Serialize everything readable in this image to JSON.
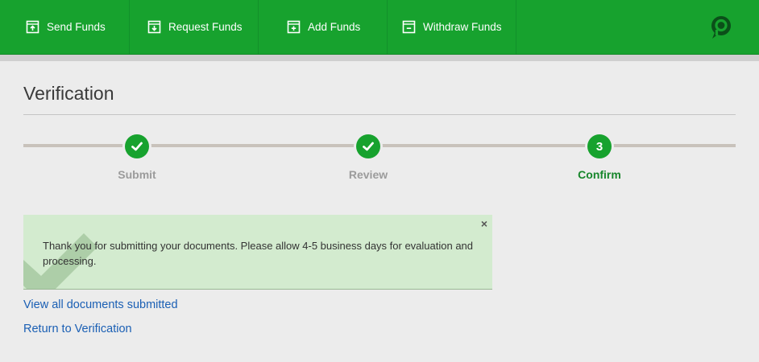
{
  "nav": {
    "items": [
      {
        "label": "Send Funds",
        "icon": "send-funds-icon"
      },
      {
        "label": "Request Funds",
        "icon": "request-funds-icon"
      },
      {
        "label": "Add Funds",
        "icon": "add-funds-icon"
      },
      {
        "label": "Withdraw Funds",
        "icon": "withdraw-funds-icon"
      }
    ],
    "logo": "brand-logo-icon"
  },
  "colors": {
    "brand_green": "#17a22e",
    "alert_background": "#d3ebcf",
    "link_blue": "#1a5fb4",
    "active_step": "#17862b",
    "inactive_step": "#9b9b9b"
  },
  "page": {
    "title": "Verification"
  },
  "steps": [
    {
      "label": "Submit",
      "status": "complete",
      "icon": "checkmark-icon"
    },
    {
      "label": "Review",
      "status": "complete",
      "icon": "checkmark-icon"
    },
    {
      "label": "Confirm",
      "status": "active",
      "number": "3"
    }
  ],
  "alert": {
    "message": "Thank you for submitting your documents. Please allow 4-5 business days for evaluation and processing.",
    "close": "×"
  },
  "links": {
    "view_docs": "View all documents submitted",
    "return": "Return to Verification"
  }
}
